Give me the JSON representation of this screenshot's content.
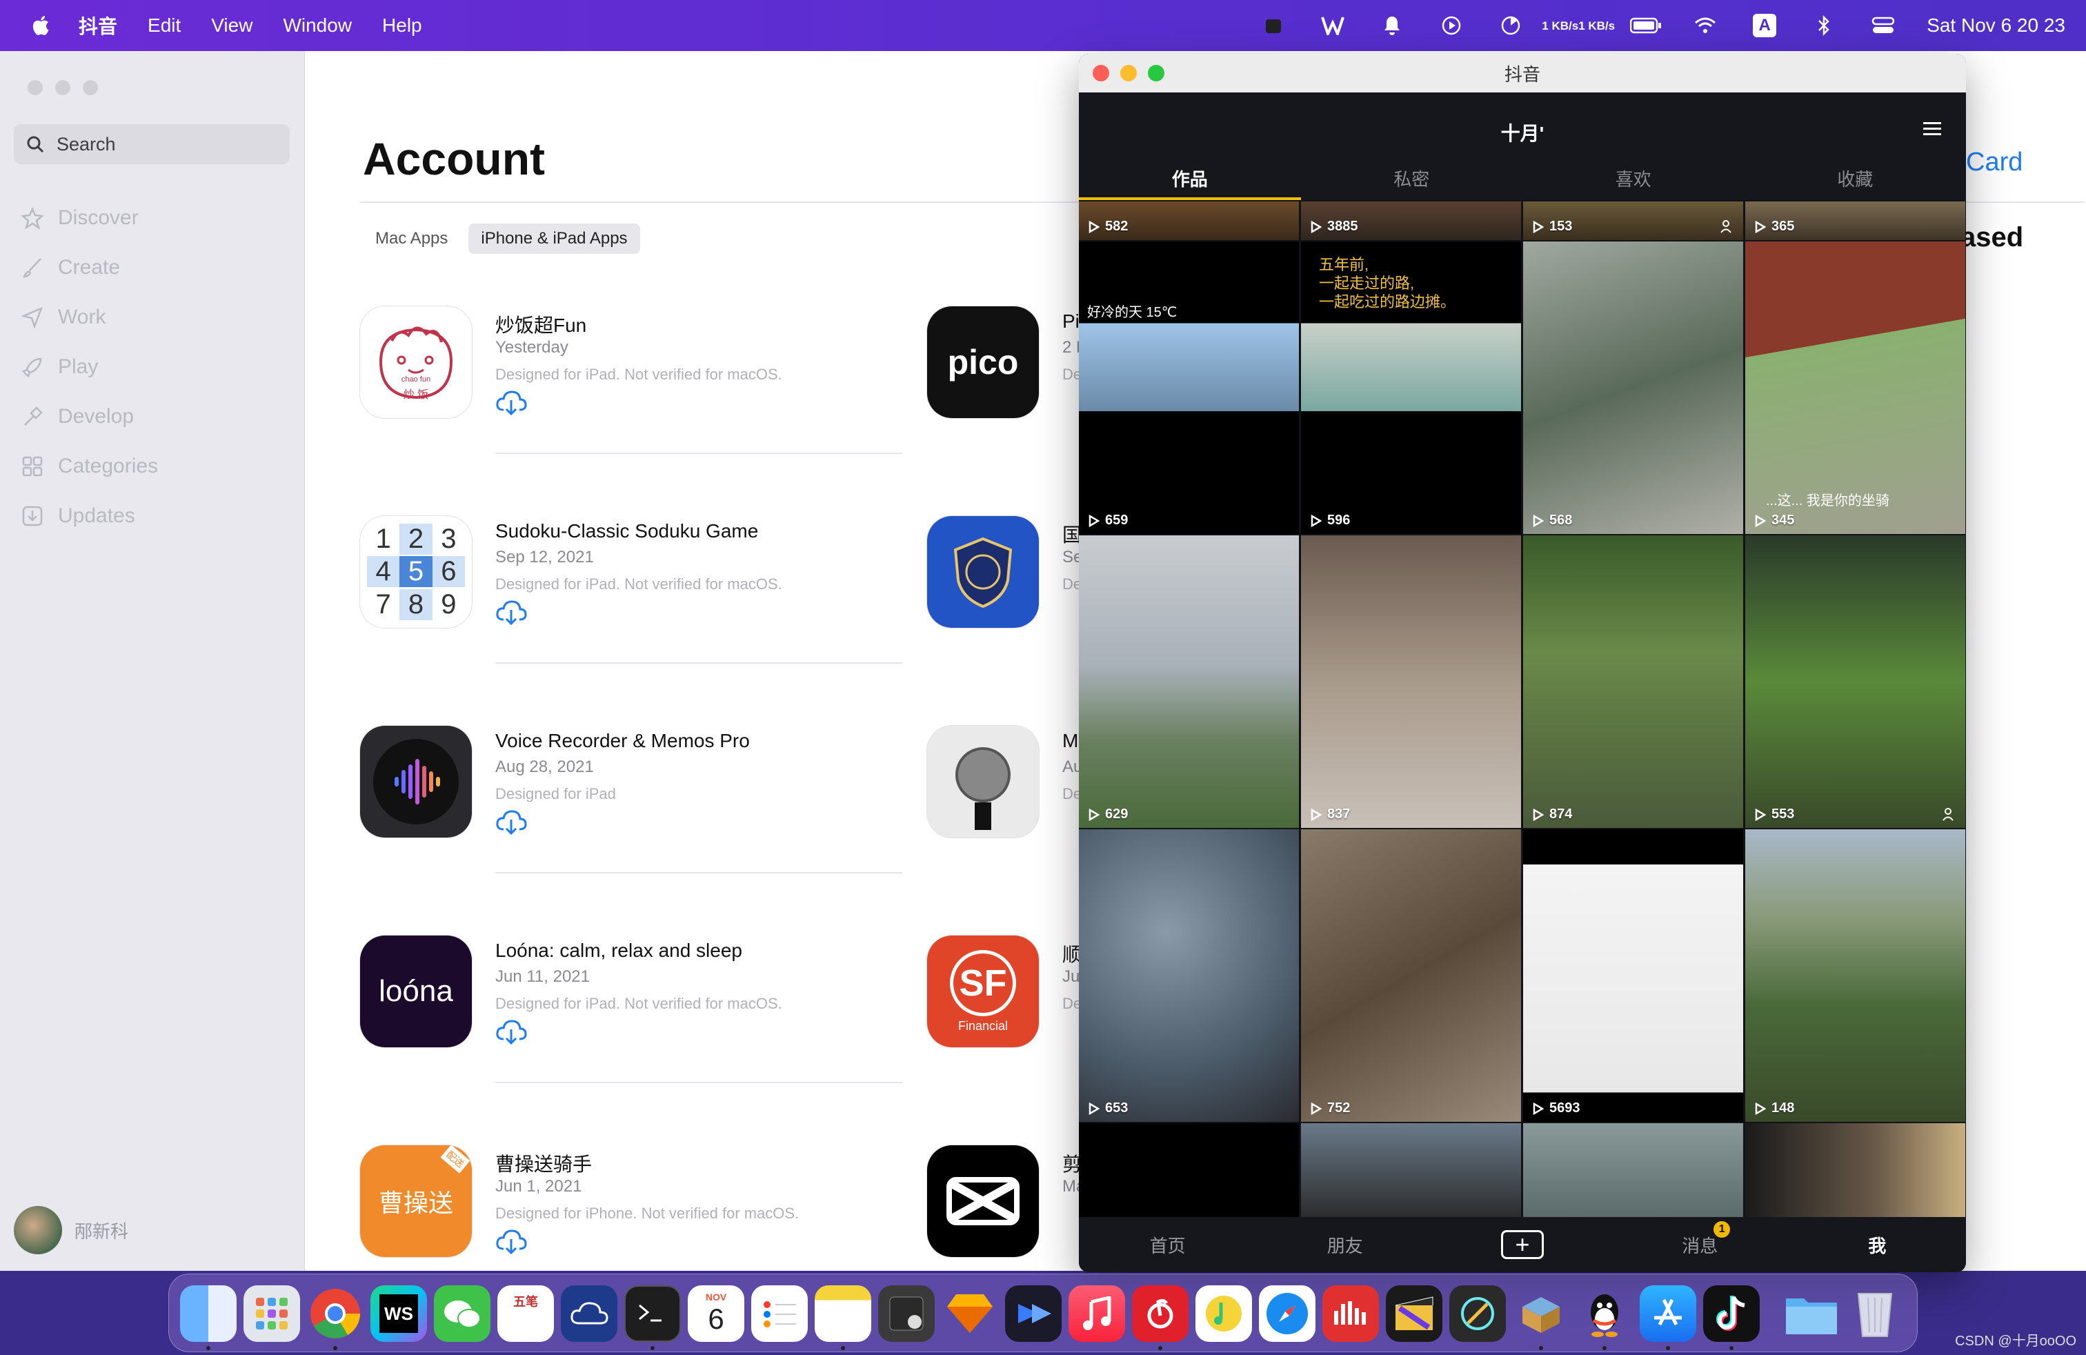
{
  "menubar": {
    "app_name": "抖音",
    "items": [
      "Edit",
      "View",
      "Window",
      "Help"
    ],
    "net_up": "1 KB/s",
    "net_down": "1 KB/s",
    "clock": "Sat Nov 6  20 23",
    "input_source": "A"
  },
  "sidebar": {
    "search_placeholder": "Search",
    "nav": [
      {
        "label": "Discover",
        "icon": "star-icon"
      },
      {
        "label": "Create",
        "icon": "brush-icon"
      },
      {
        "label": "Work",
        "icon": "paper-plane-icon"
      },
      {
        "label": "Play",
        "icon": "rocket-icon"
      },
      {
        "label": "Develop",
        "icon": "hammer-icon"
      },
      {
        "label": "Categories",
        "icon": "grid-icon"
      },
      {
        "label": "Updates",
        "icon": "download-icon"
      }
    ],
    "user_name": "邴新科"
  },
  "main": {
    "title": "Account",
    "tabs": [
      "Mac Apps",
      "iPhone & iPad Apps"
    ],
    "card_link": "Card",
    "purchased_label": "ased",
    "apps": [
      {
        "name": "炒饭超Fun",
        "date": "Yesterday",
        "note": "Designed for iPad. Not verified for macOS."
      },
      {
        "name": "Sudoku-Classic Soduku Game",
        "date": "Sep 12, 2021",
        "note": "Designed for iPad. Not verified for macOS."
      },
      {
        "name": "Voice Recorder & Memos Pro",
        "date": "Aug 28, 2021",
        "note": "Designed for iPad"
      },
      {
        "name": "Loóna: calm, relax and sleep",
        "date": "Jun 11, 2021",
        "note": "Designed for iPad. Not verified for macOS."
      },
      {
        "name": "曹操送骑手",
        "date": "Jun 1, 2021",
        "note": "Designed for iPhone. Not verified for macOS."
      }
    ],
    "apps_right": [
      {
        "name": "Pi",
        "sub": "2 D",
        "sub2": "De"
      },
      {
        "name": "国",
        "sub": "Se",
        "sub2": "De"
      },
      {
        "name": "M",
        "sub": "Au",
        "sub2": "De"
      },
      {
        "name": "顺",
        "sub": "Ju",
        "sub2": "De"
      },
      {
        "name": "剪",
        "sub": "Ma",
        "sub2": "De"
      }
    ],
    "icon_texts": {
      "chaofan_top": "chao fun",
      "chaofan_cn": "炒 饭",
      "sudoku": [
        "1",
        "2",
        "3",
        "4",
        "5",
        "6",
        "7",
        "8",
        "9"
      ],
      "loona": "loóna",
      "pico": "pico",
      "sf": "SF",
      "sf_sub": "Financial",
      "caocao": "曹操送",
      "caocao_tag": "配送"
    }
  },
  "douyin": {
    "window_title": "抖音",
    "username": "十月'",
    "tabs": [
      "作品",
      "私密",
      "喜欢",
      "收藏"
    ],
    "bottom_tabs": [
      "首页",
      "朋友",
      "消息",
      "我"
    ],
    "message_badge": "1",
    "plus": "+",
    "counts": [
      "582",
      "3885",
      "153",
      "365",
      "659",
      "596",
      "568",
      "345",
      "629",
      "837",
      "874",
      "553",
      "653",
      "752",
      "5693",
      "148"
    ],
    "overlay_weather": "好冷的天 15℃",
    "overlay_poem_1": "五年前,",
    "overlay_poem_2": "一起走过的路,",
    "overlay_poem_3": "一起吃过的路边摊。",
    "overlay_caption": "...这... 我是你的坐骑"
  },
  "dock": {
    "icons": [
      "finder-icon",
      "launchpad-icon",
      "chrome-icon",
      "webstorm-icon",
      "wechat-icon",
      "calendar-notes-icon",
      "cloud-icon",
      "terminal-icon",
      "calendar-icon",
      "reminders-icon",
      "notes-icon",
      "script-editor-icon",
      "sketch-icon",
      "video-icon",
      "music-icon",
      "netease-music-icon",
      "qq-music-icon",
      "safari-icon",
      "bilibili-like-icon",
      "final-cut-icon",
      "instruments-icon",
      "archive-icon",
      "qq-icon",
      "appstore-icon",
      "tiktok-icon",
      "downloads-folder-icon",
      "trash-icon"
    ],
    "calendar_month": "NOV",
    "calendar_day": "6",
    "ws_text": "WS",
    "memo_text": "五笔"
  },
  "watermark": "CSDN @十月ooOO"
}
